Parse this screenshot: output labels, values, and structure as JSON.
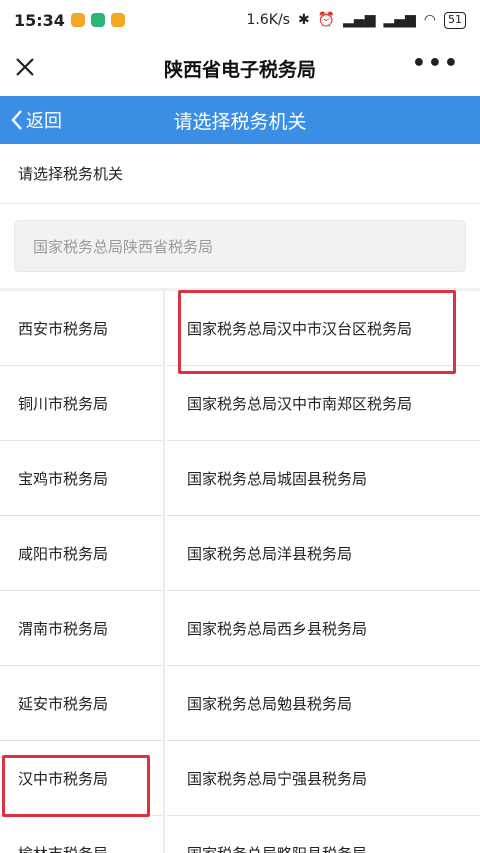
{
  "status": {
    "time": "15:34",
    "network_speed": "1.6K/s",
    "battery": "51",
    "app_icon_colors": [
      "#f5a623",
      "#2bb673",
      "#f5a623"
    ]
  },
  "titlebar": {
    "title": "陕西省电子税务局",
    "close_icon": "close-icon",
    "more_label": "•••"
  },
  "navbar": {
    "back_label": "返回",
    "title": "请选择税务机关",
    "color": "#3a8ee6"
  },
  "section_label": "请选择税务机关",
  "search": {
    "value": "国家税务总局陕西省税务局"
  },
  "left_list": [
    "西安市税务局",
    "铜川市税务局",
    "宝鸡市税务局",
    "咸阳市税务局",
    "渭南市税务局",
    "延安市税务局",
    "汉中市税务局",
    "榆林市税务局"
  ],
  "right_list": [
    "国家税务总局汉中市汉台区税务局",
    "国家税务总局汉中市南郑区税务局",
    "国家税务总局城固县税务局",
    "国家税务总局洋县税务局",
    "国家税务总局西乡县税务局",
    "国家税务总局勉县税务局",
    "国家税务总局宁强县税务局",
    "国家税务总局略阳县税务局"
  ],
  "highlight_color": "#d8343f"
}
